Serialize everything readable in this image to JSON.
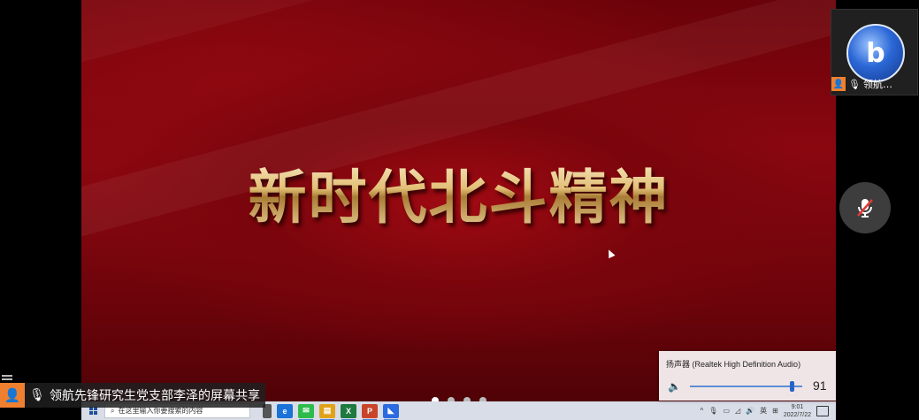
{
  "shared_screen": {
    "slide_title": "新时代北斗精神",
    "slide_dots": 4,
    "active_dot": 0
  },
  "taskbar": {
    "search_placeholder": "在这里输入你要搜索的内容",
    "apps": [
      {
        "name": "app-edge-icon",
        "glyph": "e",
        "color": "#1a73d9"
      },
      {
        "name": "app-wechat-icon",
        "glyph": "✉",
        "color": "#2dbb4c"
      },
      {
        "name": "app-files-icon",
        "glyph": "▤",
        "color": "#e0a21a"
      },
      {
        "name": "app-excel-icon",
        "glyph": "X",
        "color": "#1e7a3e"
      },
      {
        "name": "app-powerpoint-icon",
        "glyph": "P",
        "color": "#c8452a"
      },
      {
        "name": "app-tencent-meeting-icon",
        "glyph": "◣",
        "color": "#2b6ae0"
      }
    ],
    "tray_lang": "英",
    "time": "9:01",
    "date": "2022/7/22"
  },
  "volume_popup": {
    "device": "扬声器 (Realtek High Definition Audio)",
    "level": 91
  },
  "participant_tile": {
    "label": "领航…",
    "avatar_glyph": "b"
  },
  "share_label": {
    "text": "领航先锋研究生党支部李泽的屏幕共享"
  },
  "colors": {
    "slide_red": "#8a0710",
    "gold_text": "#e2bf76",
    "host_orange": "#f08030",
    "taskbar": "#d8dde7"
  }
}
